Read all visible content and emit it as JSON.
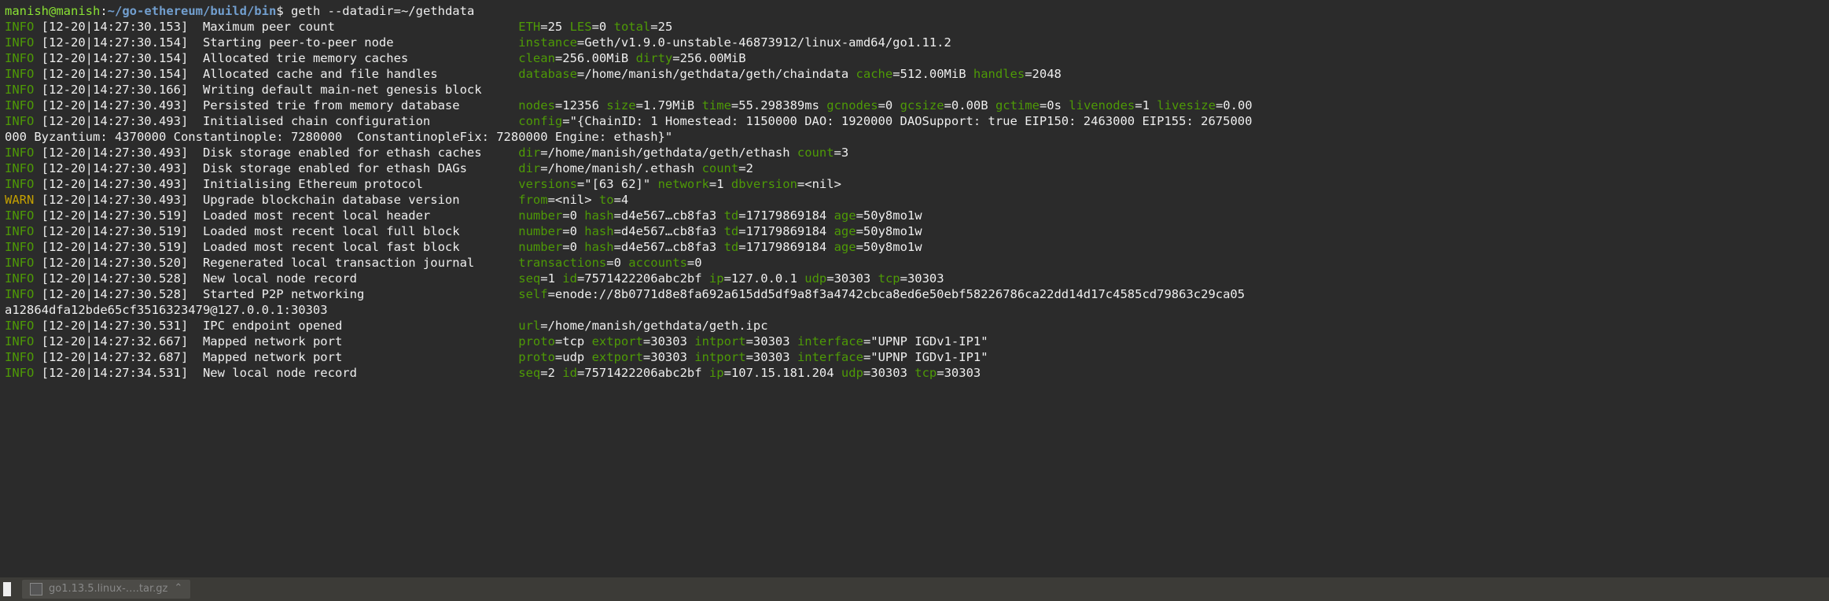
{
  "prompt": {
    "user": "manish@manish",
    "sep1": ":",
    "path": "~/go-ethereum/build/bin",
    "sep2": "$ ",
    "cmd": "geth --datadir=~/gethdata"
  },
  "lines": [
    {
      "lvl": "INFO",
      "ts": "[12-20|14:27:30.153]",
      "msg": "Maximum peer count",
      "kv": [
        [
          "ETH",
          "25"
        ],
        [
          "LES",
          "0"
        ],
        [
          "total",
          "25"
        ]
      ]
    },
    {
      "lvl": "INFO",
      "ts": "[12-20|14:27:30.154]",
      "msg": "Starting peer-to-peer node",
      "kv": [
        [
          "instance",
          "Geth/v1.9.0-unstable-46873912/linux-amd64/go1.11.2"
        ]
      ]
    },
    {
      "lvl": "INFO",
      "ts": "[12-20|14:27:30.154]",
      "msg": "Allocated trie memory caches",
      "kv": [
        [
          "clean",
          "256.00MiB"
        ],
        [
          "dirty",
          "256.00MiB"
        ]
      ]
    },
    {
      "lvl": "INFO",
      "ts": "[12-20|14:27:30.154]",
      "msg": "Allocated cache and file handles",
      "kv": [
        [
          "database",
          "/home/manish/gethdata/geth/chaindata"
        ],
        [
          "cache",
          "512.00MiB"
        ],
        [
          "handles",
          "2048"
        ]
      ]
    },
    {
      "lvl": "INFO",
      "ts": "[12-20|14:27:30.166]",
      "msg": "Writing default main-net genesis block",
      "kv": []
    },
    {
      "lvl": "INFO",
      "ts": "[12-20|14:27:30.493]",
      "msg": "Persisted trie from memory database",
      "kv": [
        [
          "nodes",
          "12356"
        ],
        [
          "size",
          "1.79MiB"
        ],
        [
          "time",
          "55.298389ms"
        ],
        [
          "gcnodes",
          "0"
        ],
        [
          "gcsize",
          "0.00B"
        ],
        [
          "gctime",
          "0s"
        ],
        [
          "livenodes",
          "1"
        ],
        [
          "livesize",
          "0.00"
        ]
      ]
    },
    {
      "lvl": "INFO",
      "ts": "[12-20|14:27:30.493]",
      "msg": "Initialised chain configuration",
      "kv": [
        [
          "config",
          "\"{ChainID: 1 Homestead: 1150000 DAO: 1920000 DAOSupport: true EIP150: 2463000 EIP155: 2675000"
        ]
      ],
      "wrap": "000 Byzantium: 4370000 Constantinople: 7280000  ConstantinopleFix: 7280000 Engine: ethash}\""
    },
    {
      "lvl": "INFO",
      "ts": "[12-20|14:27:30.493]",
      "msg": "Disk storage enabled for ethash caches",
      "kv": [
        [
          "dir",
          "/home/manish/gethdata/geth/ethash"
        ],
        [
          "count",
          "3"
        ]
      ]
    },
    {
      "lvl": "INFO",
      "ts": "[12-20|14:27:30.493]",
      "msg": "Disk storage enabled for ethash DAGs",
      "kv": [
        [
          "dir",
          "/home/manish/.ethash"
        ],
        [
          "count",
          "2"
        ]
      ]
    },
    {
      "lvl": "INFO",
      "ts": "[12-20|14:27:30.493]",
      "msg": "Initialising Ethereum protocol",
      "kv": [
        [
          "versions",
          "\"[63 62]\""
        ],
        [
          "network",
          "1"
        ],
        [
          "dbversion",
          "<nil>"
        ]
      ]
    },
    {
      "lvl": "WARN",
      "ts": "[12-20|14:27:30.493]",
      "msg": "Upgrade blockchain database version",
      "kv": [
        [
          "from",
          "<nil>"
        ],
        [
          "to",
          "4"
        ]
      ]
    },
    {
      "lvl": "INFO",
      "ts": "[12-20|14:27:30.519]",
      "msg": "Loaded most recent local header",
      "kv": [
        [
          "number",
          "0"
        ],
        [
          "hash",
          "d4e567…cb8fa3"
        ],
        [
          "td",
          "17179869184"
        ],
        [
          "age",
          "50y8mo1w"
        ]
      ]
    },
    {
      "lvl": "INFO",
      "ts": "[12-20|14:27:30.519]",
      "msg": "Loaded most recent local full block",
      "kv": [
        [
          "number",
          "0"
        ],
        [
          "hash",
          "d4e567…cb8fa3"
        ],
        [
          "td",
          "17179869184"
        ],
        [
          "age",
          "50y8mo1w"
        ]
      ]
    },
    {
      "lvl": "INFO",
      "ts": "[12-20|14:27:30.519]",
      "msg": "Loaded most recent local fast block",
      "kv": [
        [
          "number",
          "0"
        ],
        [
          "hash",
          "d4e567…cb8fa3"
        ],
        [
          "td",
          "17179869184"
        ],
        [
          "age",
          "50y8mo1w"
        ]
      ]
    },
    {
      "lvl": "INFO",
      "ts": "[12-20|14:27:30.520]",
      "msg": "Regenerated local transaction journal",
      "kv": [
        [
          "transactions",
          "0"
        ],
        [
          "accounts",
          "0"
        ]
      ]
    },
    {
      "lvl": "INFO",
      "ts": "[12-20|14:27:30.528]",
      "msg": "New local node record",
      "kv": [
        [
          "seq",
          "1"
        ],
        [
          "id",
          "7571422206abc2bf"
        ],
        [
          "ip",
          "127.0.0.1"
        ],
        [
          "udp",
          "30303"
        ],
        [
          "tcp",
          "30303"
        ]
      ]
    },
    {
      "lvl": "INFO",
      "ts": "[12-20|14:27:30.528]",
      "msg": "Started P2P networking",
      "kv": [
        [
          "self",
          "enode://8b0771d8e8fa692a615dd5df9a8f3a4742cbca8ed6e50ebf58226786ca22dd14d17c4585cd79863c29ca05"
        ]
      ],
      "wrap": "a12864dfa12bde65cf3516323479@127.0.0.1:30303"
    },
    {
      "lvl": "INFO",
      "ts": "[12-20|14:27:30.531]",
      "msg": "IPC endpoint opened",
      "kv": [
        [
          "url",
          "/home/manish/gethdata/geth.ipc"
        ]
      ]
    },
    {
      "lvl": "INFO",
      "ts": "[12-20|14:27:32.667]",
      "msg": "Mapped network port",
      "kv": [
        [
          "proto",
          "tcp"
        ],
        [
          "extport",
          "30303"
        ],
        [
          "intport",
          "30303"
        ],
        [
          "interface",
          "\"UPNP IGDv1-IP1\""
        ]
      ]
    },
    {
      "lvl": "INFO",
      "ts": "[12-20|14:27:32.687]",
      "msg": "Mapped network port",
      "kv": [
        [
          "proto",
          "udp"
        ],
        [
          "extport",
          "30303"
        ],
        [
          "intport",
          "30303"
        ],
        [
          "interface",
          "\"UPNP IGDv1-IP1\""
        ]
      ]
    },
    {
      "lvl": "INFO",
      "ts": "[12-20|14:27:34.531]",
      "msg": "New local node record",
      "kv": [
        [
          "seq",
          "2"
        ],
        [
          "id",
          "7571422206abc2bf"
        ],
        [
          "ip",
          "107.15.181.204"
        ],
        [
          "udp",
          "30303"
        ],
        [
          "tcp",
          "30303"
        ]
      ]
    }
  ],
  "layout": {
    "msg_width": 42,
    "kv_col": 65
  },
  "taskbar": {
    "download_label": "go1.13.5.linux-….tar.gz"
  }
}
